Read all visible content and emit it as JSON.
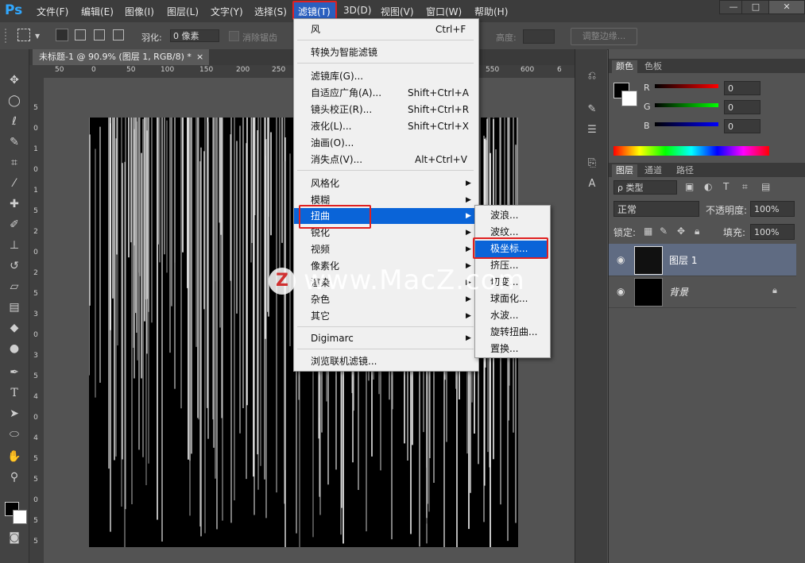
{
  "app": {
    "logo": "Ps"
  },
  "menubar": {
    "items": [
      {
        "label": "文件(F)"
      },
      {
        "label": "编辑(E)"
      },
      {
        "label": "图像(I)"
      },
      {
        "label": "图层(L)"
      },
      {
        "label": "文字(Y)"
      },
      {
        "label": "选择(S)"
      },
      {
        "label": "滤镜(T)"
      },
      {
        "label": "3D(D)"
      },
      {
        "label": "视图(V)"
      },
      {
        "label": "窗口(W)"
      },
      {
        "label": "帮助(H)"
      }
    ],
    "window_buttons": [
      "—",
      "□",
      "✕"
    ]
  },
  "options_bar": {
    "feather_label": "羽化:",
    "feather_value": "0 像素",
    "antialias_label": "消除锯齿",
    "height_label": "高度:",
    "refine_edge_label": "调整边缘..."
  },
  "document": {
    "tab_title": "未标题-1 @ 90.9% (图层 1, RGB/8) *",
    "tab_close": "×",
    "ruler_top": [
      "50",
      "0",
      "50",
      "100",
      "150",
      "200",
      "250",
      "550",
      "600",
      "6"
    ],
    "ruler_left": [
      "5",
      "0",
      "1",
      "0",
      "1",
      "5",
      "2",
      "0",
      "2",
      "5",
      "3",
      "0",
      "3",
      "5",
      "4",
      "0",
      "4",
      "5",
      "5",
      "0",
      "5",
      "5"
    ]
  },
  "filter_menu": {
    "items": [
      {
        "label": "风",
        "shortcut": "Ctrl+F"
      },
      {
        "label": "转换为智能滤镜",
        "shortcut": ""
      },
      {
        "label": "滤镜库(G)...",
        "shortcut": ""
      },
      {
        "label": "自适应广角(A)...",
        "shortcut": "Shift+Ctrl+A"
      },
      {
        "label": "镜头校正(R)...",
        "shortcut": "Shift+Ctrl+R"
      },
      {
        "label": "液化(L)...",
        "shortcut": "Shift+Ctrl+X"
      },
      {
        "label": "油画(O)...",
        "shortcut": ""
      },
      {
        "label": "消失点(V)...",
        "shortcut": "Alt+Ctrl+V"
      },
      {
        "label": "风格化",
        "shortcut": ""
      },
      {
        "label": "模糊",
        "shortcut": ""
      },
      {
        "label": "扭曲",
        "shortcut": ""
      },
      {
        "label": "锐化",
        "shortcut": ""
      },
      {
        "label": "视频",
        "shortcut": ""
      },
      {
        "label": "像素化",
        "shortcut": ""
      },
      {
        "label": "渲染",
        "shortcut": ""
      },
      {
        "label": "杂色",
        "shortcut": ""
      },
      {
        "label": "其它",
        "shortcut": ""
      },
      {
        "label": "Digimarc",
        "shortcut": ""
      },
      {
        "label": "浏览联机滤镜...",
        "shortcut": ""
      }
    ],
    "arrow": "▶"
  },
  "distort_submenu": {
    "items": [
      {
        "label": "波浪..."
      },
      {
        "label": "波纹..."
      },
      {
        "label": "极坐标..."
      },
      {
        "label": "挤压..."
      },
      {
        "label": "切变..."
      },
      {
        "label": "球面化..."
      },
      {
        "label": "水波..."
      },
      {
        "label": "旋转扭曲..."
      },
      {
        "label": "置换..."
      }
    ]
  },
  "color_panel": {
    "tabs": [
      "颜色",
      "色板"
    ],
    "channels": [
      {
        "label": "R",
        "value": "0"
      },
      {
        "label": "G",
        "value": "0"
      },
      {
        "label": "B",
        "value": "0"
      }
    ]
  },
  "layers_panel": {
    "tabs": [
      "图层",
      "通道",
      "路径"
    ],
    "filter_kind": "ρ 类型",
    "blend_mode": "正常",
    "opacity_label": "不透明度:",
    "opacity_value": "100%",
    "lock_label": "锁定:",
    "fill_label": "填充:",
    "fill_value": "100%",
    "layers": [
      {
        "name": "图层 1"
      },
      {
        "name": "背景"
      }
    ]
  },
  "watermark": {
    "logo_letter": "Z",
    "text": "www.MacZ.com"
  },
  "colors": {
    "menu_highlight": "#0a64d8",
    "annotation_red": "#e02020",
    "ps_blue": "#31a8ff"
  }
}
